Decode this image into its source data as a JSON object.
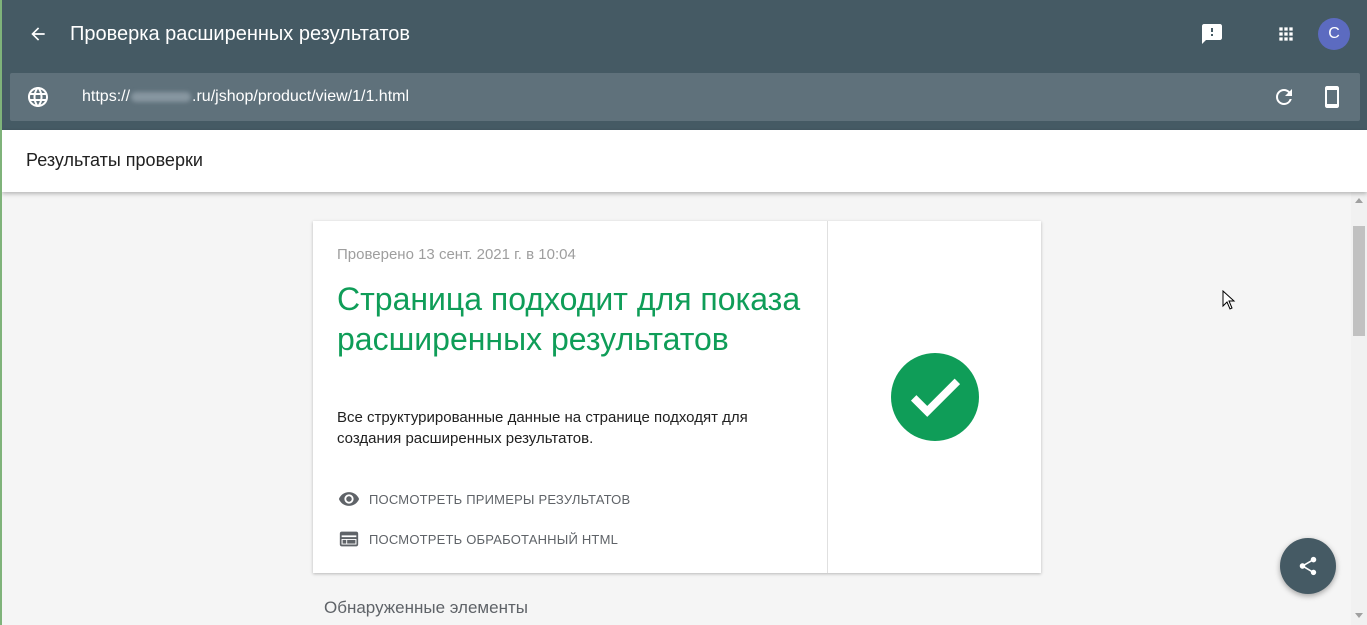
{
  "app": {
    "title": "Проверка расширенных результатов",
    "avatar_letter": "С",
    "accent": "#455a64"
  },
  "url": {
    "prefix": "https://",
    "suffix": ".ru/jshop/product/view/1/1.html"
  },
  "section": {
    "title": "Результаты проверки"
  },
  "result": {
    "checked_on": "Проверено 13 сент. 2021 г. в 10:04",
    "heading": "Страница подходит для показа расширенных результатов",
    "description": "Все структурированные данные на странице подходят для создания расширенных результатов.",
    "status_color": "#0f9d58",
    "actions": [
      {
        "icon": "eye-icon",
        "label": "ПОСМОТРЕТЬ ПРИМЕРЫ РЕЗУЛЬТАТОВ"
      },
      {
        "icon": "web-page-icon",
        "label": "ПОСМОТРЕТЬ ОБРАБОТАННЫЙ HTML"
      }
    ]
  },
  "detected": {
    "title": "Обнаруженные элементы"
  }
}
